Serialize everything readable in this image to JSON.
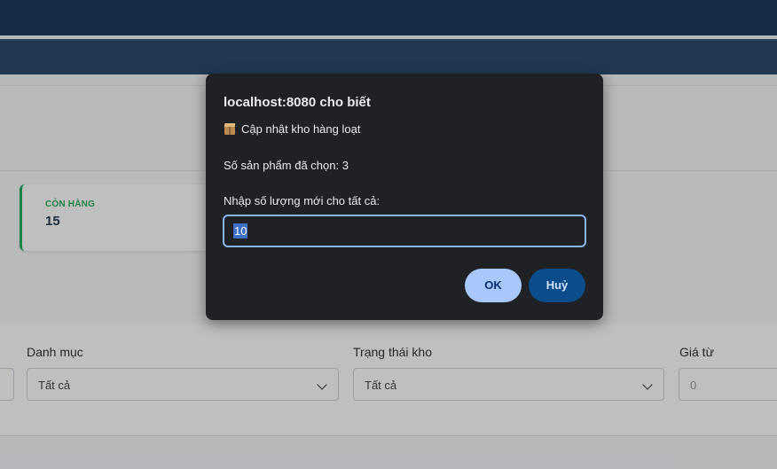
{
  "stats": {
    "in_stock_label": "CÒN HÀNG",
    "in_stock_value": "15"
  },
  "filters": {
    "category_label": "Danh mục",
    "category_value": "Tất cả",
    "stock_status_label": "Trạng thái kho",
    "stock_status_value": "Tất cả",
    "price_from_label": "Giá từ",
    "price_from_placeholder": "0"
  },
  "dialog": {
    "title": "localhost:8080 cho biết",
    "heading": "Cập nhật kho hàng loạt",
    "heading_icon": "package-icon",
    "selected_count_text": "Số sản phẩm đã chọn: 3",
    "prompt": "Nhập số lượng mới cho tất cả:",
    "input_value": "10",
    "ok_label": "OK",
    "cancel_label": "Huỷ"
  },
  "colors": {
    "header_bg": "#1e3a5f",
    "in_stock_accent": "#27ae60",
    "dialog_bg": "#202124",
    "ok_button": "#a8c7fa",
    "cancel_button": "#0b4c8a",
    "input_focus": "#8ab4f8"
  }
}
